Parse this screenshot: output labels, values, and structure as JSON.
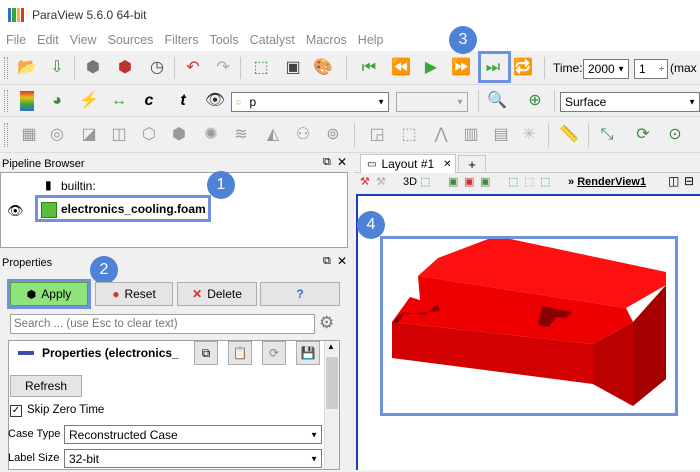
{
  "app": {
    "title": "ParaView 5.6.0 64-bit"
  },
  "menu": [
    "File",
    "Edit",
    "View",
    "Sources",
    "Filters",
    "Tools",
    "Catalyst",
    "Macros",
    "Help"
  ],
  "time": {
    "label": "Time:",
    "value": "2000",
    "index": "1",
    "max_label": "(max i"
  },
  "toolbar2": {
    "array_value": "p",
    "representation": "Surface"
  },
  "pipeline": {
    "title": "Pipeline Browser",
    "builtin": "builtin:",
    "source": "electronics_cooling.foam"
  },
  "properties": {
    "title": "Properties",
    "apply": "Apply",
    "reset": "Reset",
    "delete": "Delete",
    "help": "?",
    "search_placeholder": "Search ... (use Esc to clear text)",
    "section": "Properties (electronics_",
    "refresh": "Refresh",
    "skip_zero_time": "Skip Zero Time",
    "case_type_label": "Case Type",
    "case_type_value": "Reconstructed Case",
    "label_size_label": "Label Size",
    "label_size_value": "32-bit"
  },
  "layout": {
    "tab": "Layout #1",
    "add_tab": "+",
    "view_3d": "3D",
    "render_view": "RenderView1"
  },
  "callouts": [
    "1",
    "2",
    "3",
    "4"
  ],
  "colors": {
    "accent": "#4d82d6",
    "highlight": "#6e92de",
    "model_red": "#ff0000",
    "apply_green": "#8ee37a"
  }
}
